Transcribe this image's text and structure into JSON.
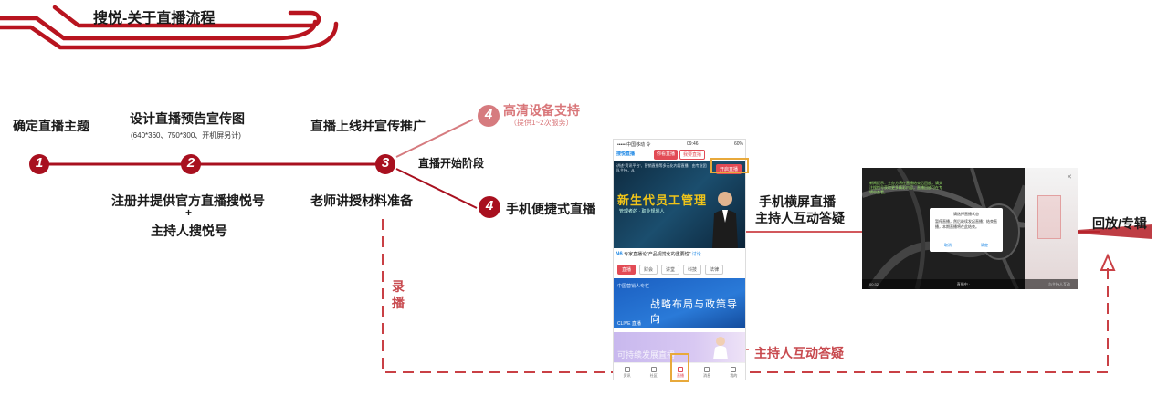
{
  "header": {
    "title": "搜悦-关于直播流程"
  },
  "steps": [
    {
      "num": "1",
      "label": "确定直播主题"
    },
    {
      "num": "2",
      "label": "设计直播预告宣传图",
      "note": "(640*360、750*300、开机屏另计)"
    },
    {
      "num": "3",
      "label": "直播上线并宣传推广"
    },
    {
      "num": "4",
      "label": "高清设备支持",
      "note": "（提供1~2次服务）"
    },
    {
      "num": "4",
      "label": "手机便捷式直播"
    }
  ],
  "below": {
    "register_line1": "注册并提供官方直播搜悦号",
    "plus": "+",
    "register_line2": "主持人搜悦号",
    "teacher": "老师讲授材料准备"
  },
  "stage": "直播开始阶段",
  "record": [
    "录",
    "播"
  ],
  "landscape_label": {
    "line1": "手机横屏直播",
    "line2": "主持人互动答疑"
  },
  "interaction": "主持人互动答疑",
  "replay": "回放/专辑",
  "phone": {
    "carrier": "••••• 中国移动 令",
    "time": "09:46",
    "battery": "60%",
    "brand": "搜悦直播",
    "tabs": [
      "你看直播",
      "我要直播"
    ],
    "video_note": "讲述“资讯平台”、营销直播等多元化内容直播，由专业团队主持，从",
    "video_title": "新生代员工管理",
    "video_sub": "管理者的 · 职业规划人",
    "start_button": "开启直播",
    "news_brand": "N6",
    "news_text": "专家直播论“产品视觉化的重要性”",
    "news_tag": "讨论",
    "categories": [
      "直播",
      "财会",
      "讲堂",
      "科技",
      "法律"
    ],
    "banner1_title": "战略布局与政策导向",
    "banner1_logo": "中国营销人专栏",
    "banner1_tag": "CLIVE 直播",
    "banner2_text": "可持续发展直播",
    "nav": [
      "资讯",
      "社区",
      "直播",
      "消息",
      "我的"
    ]
  },
  "landscape": {
    "note": "新闻提示：主办方将在直播结束后回放，请关注搜悦号获取更多精彩内容，直播回放可在专辑中查看。",
    "dialog_title": "请选择直播状态",
    "dialog_body": "暂停直播，然后继续发起直播；结束直播，本期直播将在此结束。",
    "dialog_cancel": "取消",
    "dialog_ok": "确定",
    "bar_left": "00:32",
    "bar_mid": "直播中 ·",
    "bar_right": "与主持人互动"
  },
  "colors": {
    "main_red": "#a8101f",
    "pale_red": "#d2585c",
    "accent_orange": "#e8a93b"
  }
}
